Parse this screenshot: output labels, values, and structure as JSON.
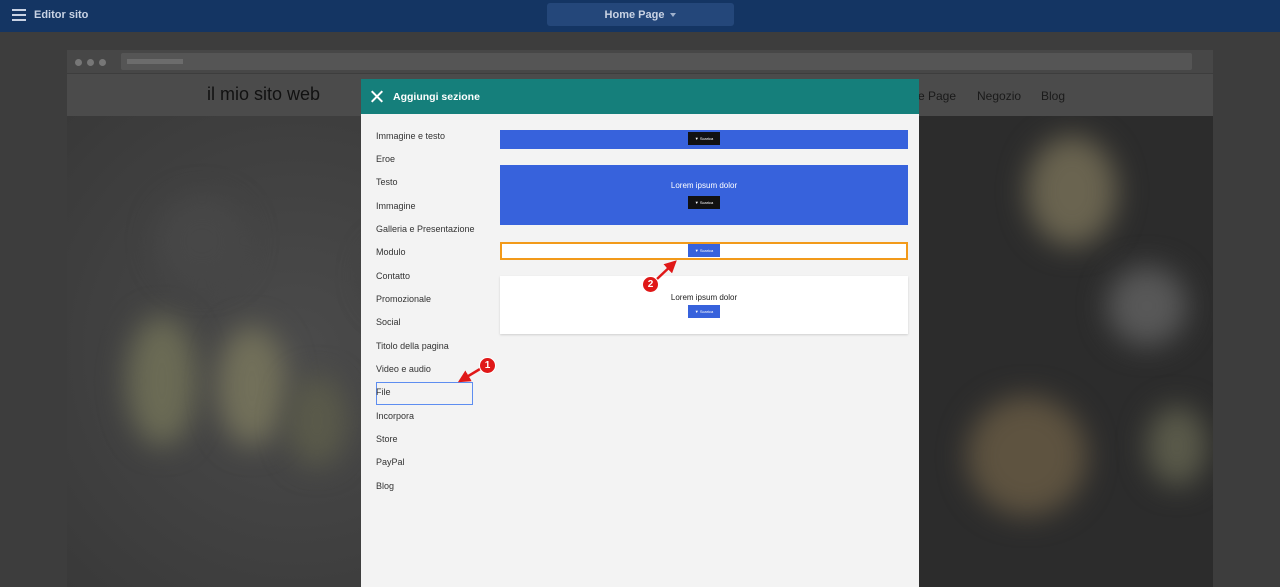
{
  "topbar": {
    "app_title": "Editor sito",
    "page_selector": "Home Page"
  },
  "site": {
    "title": "il mio sito web",
    "nav": [
      "e Page",
      "Negozio",
      "Blog"
    ]
  },
  "modal": {
    "title": "Aggiungi sezione",
    "categories": [
      "Immagine e testo",
      "Eroe",
      "Testo",
      "Immagine",
      "Galleria e Presentazione",
      "Modulo",
      "Contatto",
      "Promozionale",
      "Social",
      "Titolo della pagina",
      "Video e audio",
      "File",
      "Incorpora",
      "Store",
      "PayPal",
      "Blog"
    ],
    "selected_category": "File",
    "previews": {
      "heading_text": "Lorem ipsum dolor",
      "button_label": "Scarica"
    }
  },
  "annotations": {
    "marker_1": "1",
    "marker_2": "2"
  },
  "colors": {
    "topbar": "#143563",
    "modal_header": "#157f7b",
    "preview_blue": "#3762dc",
    "highlight_orange": "#f29a1a",
    "marker_red": "#e01818"
  }
}
